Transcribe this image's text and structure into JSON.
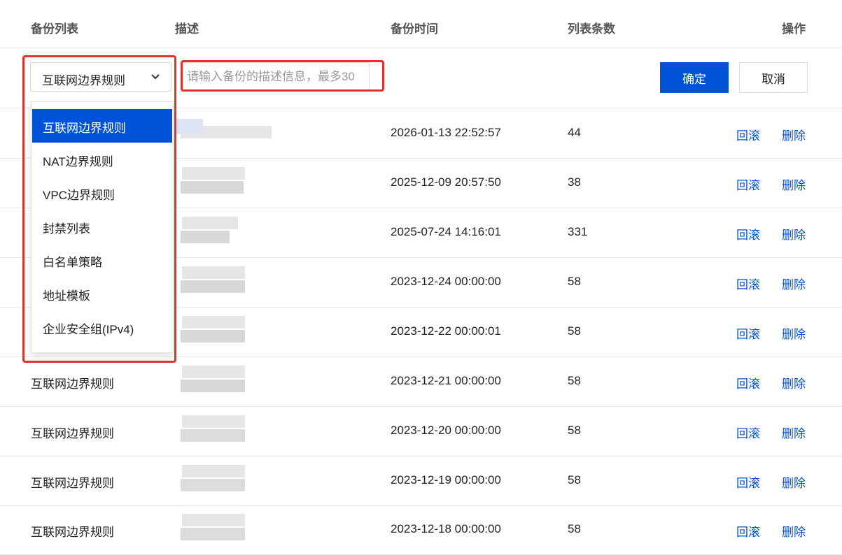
{
  "table": {
    "headers": {
      "backup_list": "备份列表",
      "description": "描述",
      "backup_time": "备份时间",
      "count": "列表条数",
      "actions": "操作"
    }
  },
  "edit_row": {
    "select_value": "互联网边界规则",
    "description_placeholder": "请输入备份的描述信息，最多30",
    "confirm_label": "确定",
    "cancel_label": "取消"
  },
  "dropdown": {
    "options": [
      "互联网边界规则",
      "NAT边界规则",
      "VPC边界规则",
      "封禁列表",
      "白名单策略",
      "地址模板",
      "企业安全组(IPv4)"
    ],
    "selected": "互联网边界规则"
  },
  "rows": [
    {
      "list": "",
      "time": "2026-01-13 22:52:57",
      "count": "44",
      "rollback": "回滚",
      "delete": "删除"
    },
    {
      "list": "",
      "time": "2025-12-09 20:57:50",
      "count": "38",
      "rollback": "回滚",
      "delete": "删除"
    },
    {
      "list": "",
      "time": "2025-07-24 14:16:01",
      "count": "331",
      "rollback": "回滚",
      "delete": "删除"
    },
    {
      "list": "",
      "time": "2023-12-24 00:00:00",
      "count": "58",
      "rollback": "回滚",
      "delete": "删除"
    },
    {
      "list": "",
      "time": "2023-12-22 00:00:01",
      "count": "58",
      "rollback": "回滚",
      "delete": "删除"
    },
    {
      "list": "互联网边界规则",
      "time": "2023-12-21 00:00:00",
      "count": "58",
      "rollback": "回滚",
      "delete": "删除"
    },
    {
      "list": "互联网边界规则",
      "time": "2023-12-20 00:00:00",
      "count": "58",
      "rollback": "回滚",
      "delete": "删除"
    },
    {
      "list": "互联网边界规则",
      "time": "2023-12-19 00:00:00",
      "count": "58",
      "rollback": "回滚",
      "delete": "删除"
    },
    {
      "list": "互联网边界规则",
      "time": "2023-12-18 00:00:00",
      "count": "58",
      "rollback": "回滚",
      "delete": "删除"
    }
  ],
  "colors": {
    "primary": "#0052d9",
    "highlight": "#e5312b",
    "border": "#e7e7e7"
  }
}
